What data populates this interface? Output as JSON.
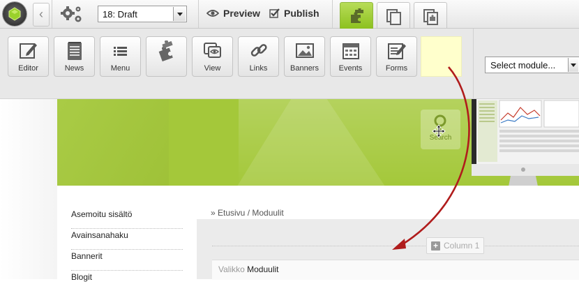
{
  "topbar": {
    "version_select": "18: Draft",
    "preview_label": "Preview",
    "publish_label": "Publish"
  },
  "ribbon": {
    "modules": [
      {
        "label": "Editor",
        "icon": "pencil-icon"
      },
      {
        "label": "News",
        "icon": "notepad-icon"
      },
      {
        "label": "Menu",
        "icon": "list-icon"
      },
      {
        "label": "",
        "icon": "puzzle-icon"
      },
      {
        "label": "View",
        "icon": "view-icon"
      },
      {
        "label": "Links",
        "icon": "chain-link-icon"
      },
      {
        "label": "Banners",
        "icon": "image-icon"
      },
      {
        "label": "Events",
        "icon": "calendar-icon"
      },
      {
        "label": "Forms",
        "icon": "form-icon"
      }
    ],
    "module_select": "Select module..."
  },
  "page": {
    "search_label": "Search",
    "nav": [
      "Asemoitu sisältö",
      "Avainsanahaku",
      "Bannerit",
      "Blogit"
    ],
    "breadcrumb": "» Etusivu / Moduulit",
    "column_chip": "Column 1",
    "valikko_key": "Valikko",
    "valikko_value": "Moduulit"
  },
  "colors": {
    "accent_green": "#a4c83a",
    "drop_target": "#ffffcc",
    "arrow_red": "#b01c1c"
  }
}
